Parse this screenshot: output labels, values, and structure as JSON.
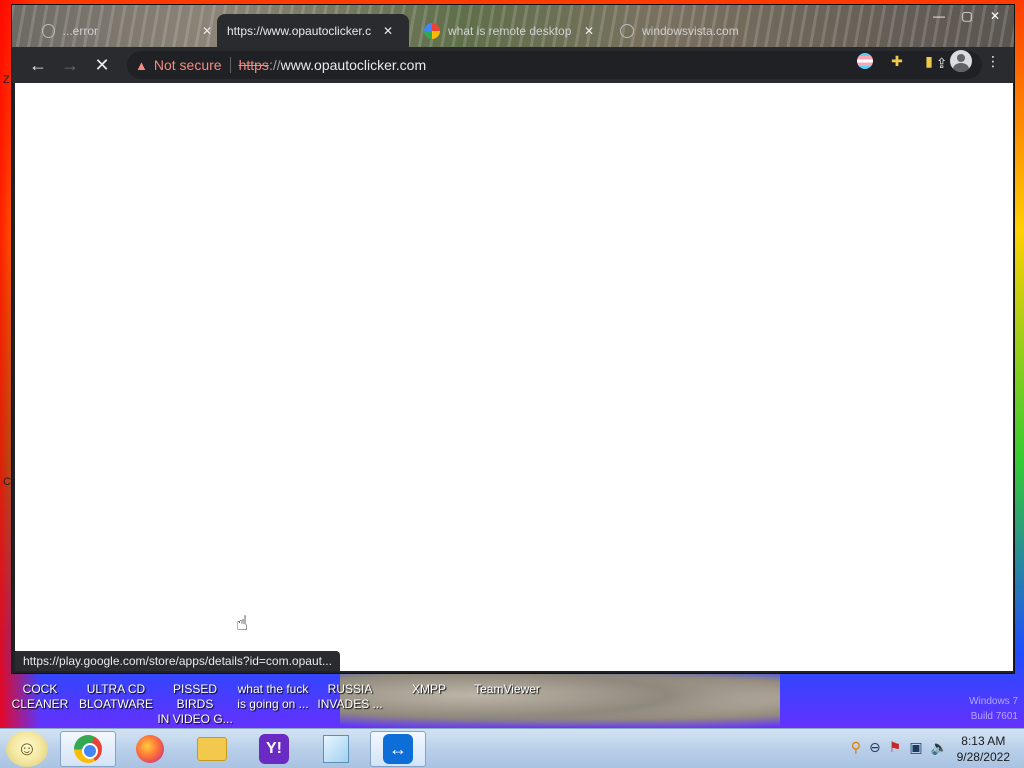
{
  "browser": {
    "tabs": [
      {
        "title": "...error",
        "active": false
      },
      {
        "title": "https://www.opautoclicker.c",
        "active": true
      },
      {
        "title": "what is remote desktop",
        "active": false
      },
      {
        "title": "windowsvista.com",
        "active": false
      }
    ],
    "address": {
      "security_label": "Not secure",
      "scheme": "https",
      "separator": "://",
      "host": "www.opautoclicker.com"
    },
    "status_url": "https://play.google.com/store/apps/details?id=com.opaut..."
  },
  "desktop": {
    "edge_letters": [
      "Z",
      "C"
    ],
    "icons": [
      {
        "line1": "COCK",
        "line2": "CLEANER"
      },
      {
        "line1": "ULTRA CD",
        "line2": "BLOATWARE"
      },
      {
        "line1": "PISSED BIRDS",
        "line2": "IN VIDEO G..."
      },
      {
        "line1": "what the fuck",
        "line2": "is going on ..."
      },
      {
        "line1": "RUSSIA",
        "line2": "INVADES ..."
      },
      {
        "line1": "XMPP",
        "line2": ""
      },
      {
        "line1": "TeamViewer",
        "line2": ""
      }
    ],
    "watermark": {
      "line1": "Windows 7",
      "line2": "Build 7601"
    }
  },
  "taskbar": {
    "yahoo_letter": "Y!",
    "clock": {
      "time": "8:13 AM",
      "date": "9/28/2022"
    }
  },
  "icons": {
    "back": "back-arrow-icon",
    "forward": "forward-arrow-icon",
    "stop": "stop-loading-icon",
    "share": "share-icon",
    "bookmark": "star-icon",
    "extensions": "puzzle-icon",
    "sidepanel": "side-panel-icon",
    "profile": "avatar-icon",
    "menu": "kebab-menu-icon"
  }
}
